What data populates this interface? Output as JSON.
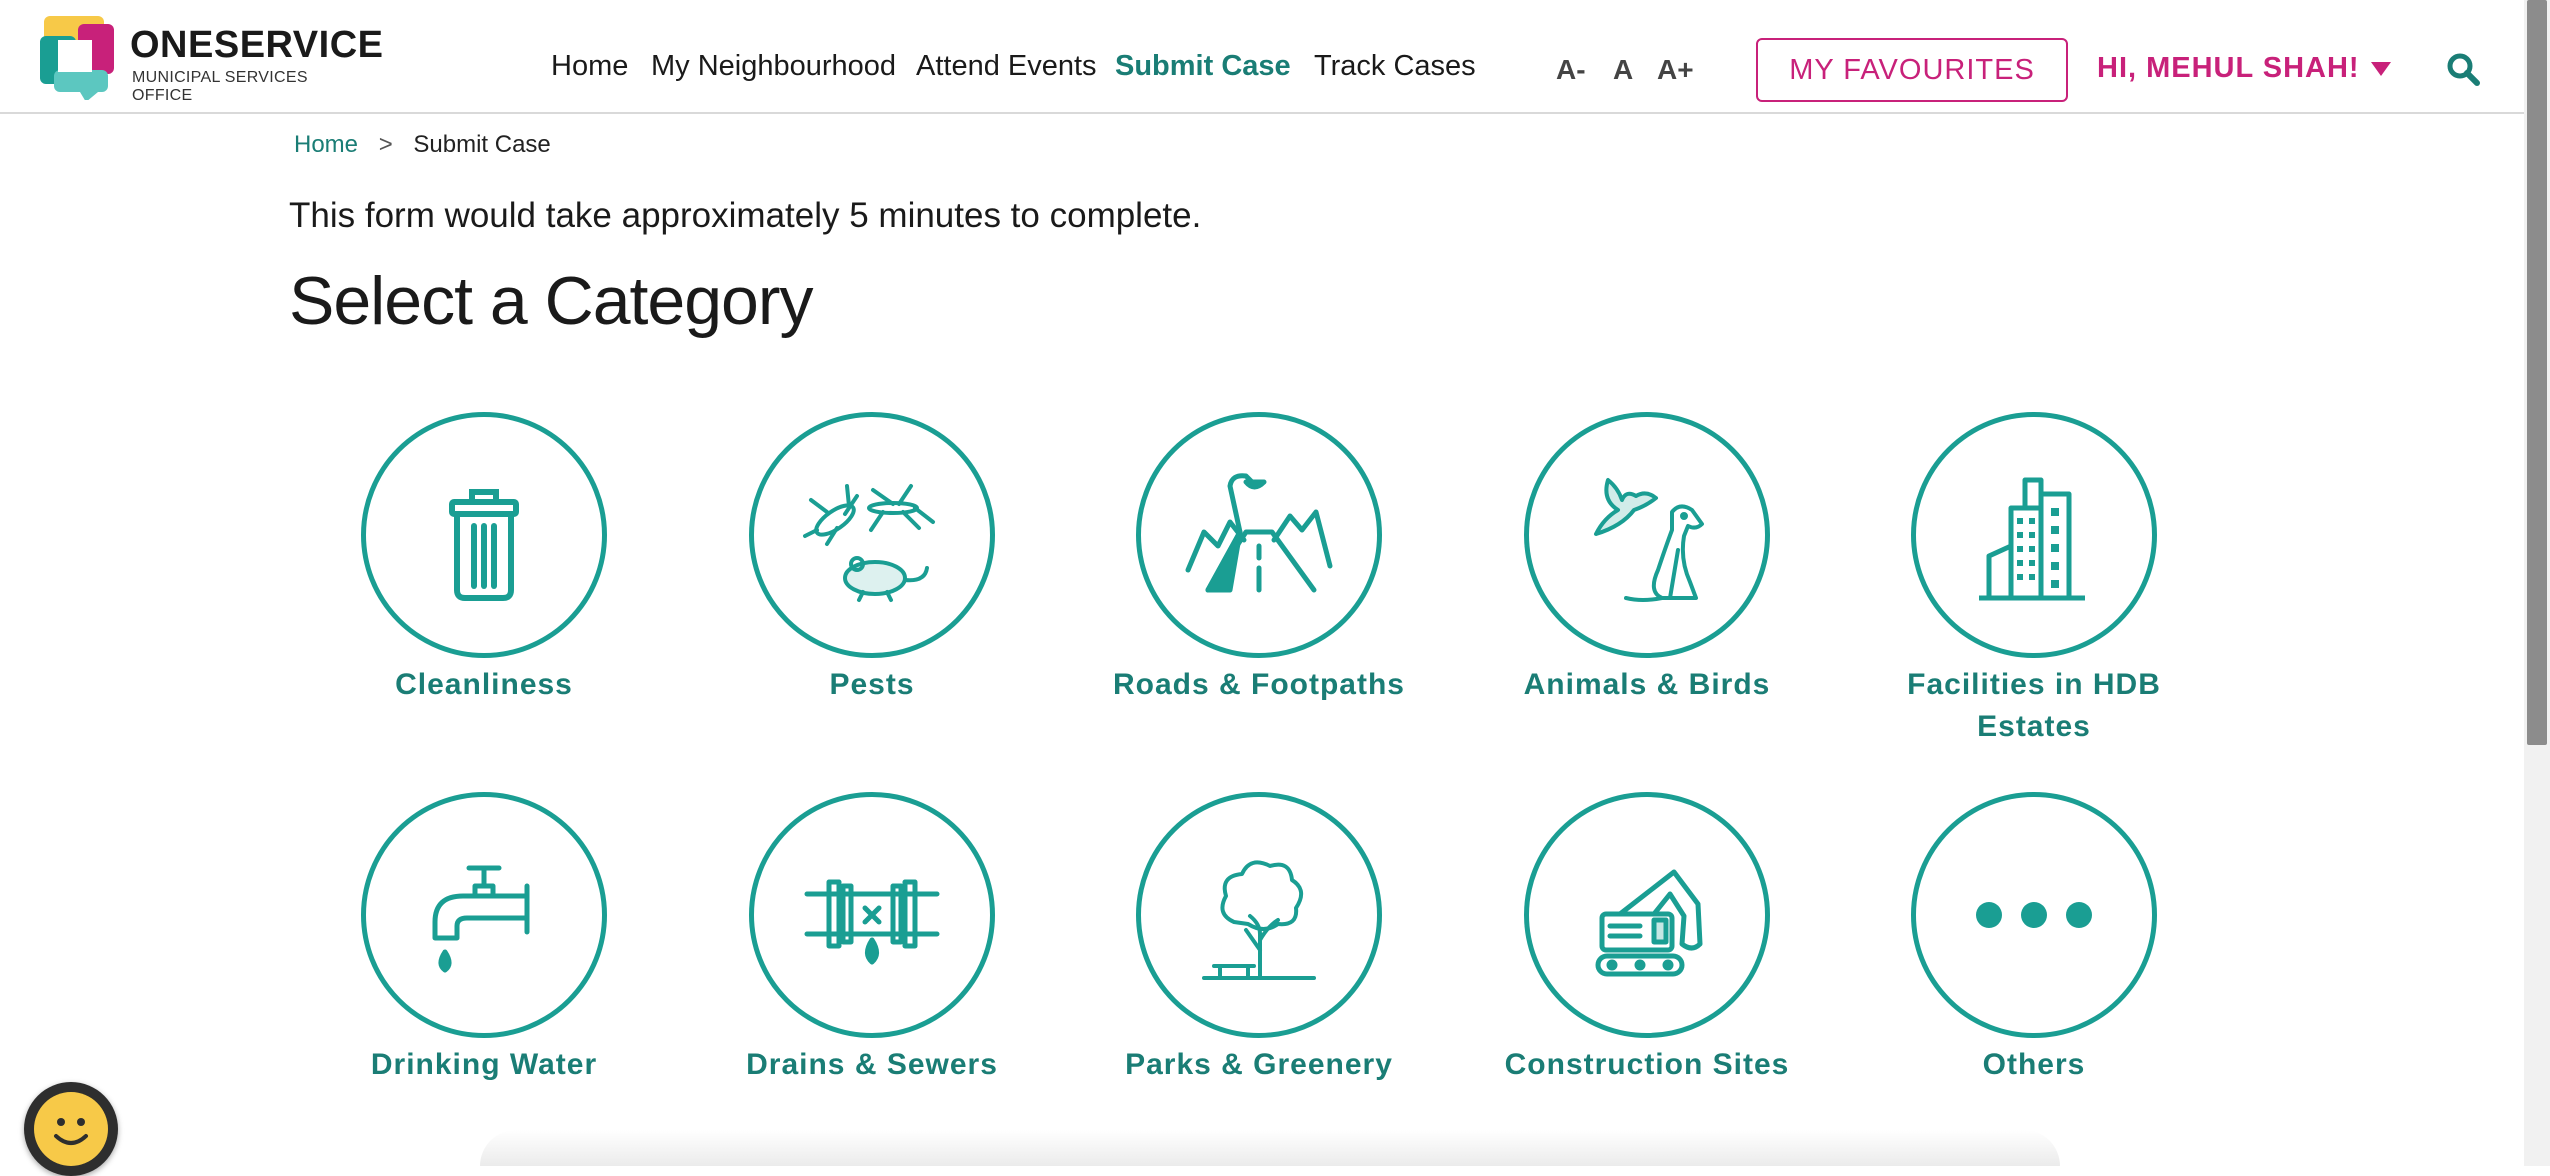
{
  "brand": {
    "title": "ONESERVICE",
    "subtitle": "MUNICIPAL SERVICES OFFICE",
    "colors": {
      "teal": "#1a9e93",
      "magenta": "#c8217a",
      "yellow": "#f7c948"
    }
  },
  "nav": {
    "items": [
      {
        "label": "Home"
      },
      {
        "label": "My Neighbourhood"
      },
      {
        "label": "Attend Events"
      },
      {
        "label": "Submit Case"
      },
      {
        "label": "Track Cases"
      }
    ],
    "active": "Submit Case"
  },
  "font_controls": {
    "decrease": "A-",
    "normal": "A",
    "increase": "A+"
  },
  "favourites_label": "MY FAVOURITES",
  "greeting": "HI, MEHUL SHAH!",
  "breadcrumb": {
    "home": "Home",
    "separator": ">",
    "current": "Submit Case"
  },
  "intro": "This form would take approximately 5 minutes to complete.",
  "title": "Select a Category",
  "categories": [
    {
      "label": "Cleanliness",
      "icon": "trash-bin-icon"
    },
    {
      "label": "Pests",
      "icon": "pests-icon"
    },
    {
      "label": "Roads & Footpaths",
      "icon": "road-icon"
    },
    {
      "label": "Animals & Birds",
      "icon": "animals-birds-icon"
    },
    {
      "label": "Facilities in HDB Estates",
      "icon": "buildings-icon"
    },
    {
      "label": "Drinking Water",
      "icon": "water-tap-icon"
    },
    {
      "label": "Drains & Sewers",
      "icon": "pipe-icon"
    },
    {
      "label": "Parks & Greenery",
      "icon": "tree-icon"
    },
    {
      "label": "Construction Sites",
      "icon": "excavator-icon"
    },
    {
      "label": "Others",
      "icon": "more-dots-icon"
    }
  ]
}
